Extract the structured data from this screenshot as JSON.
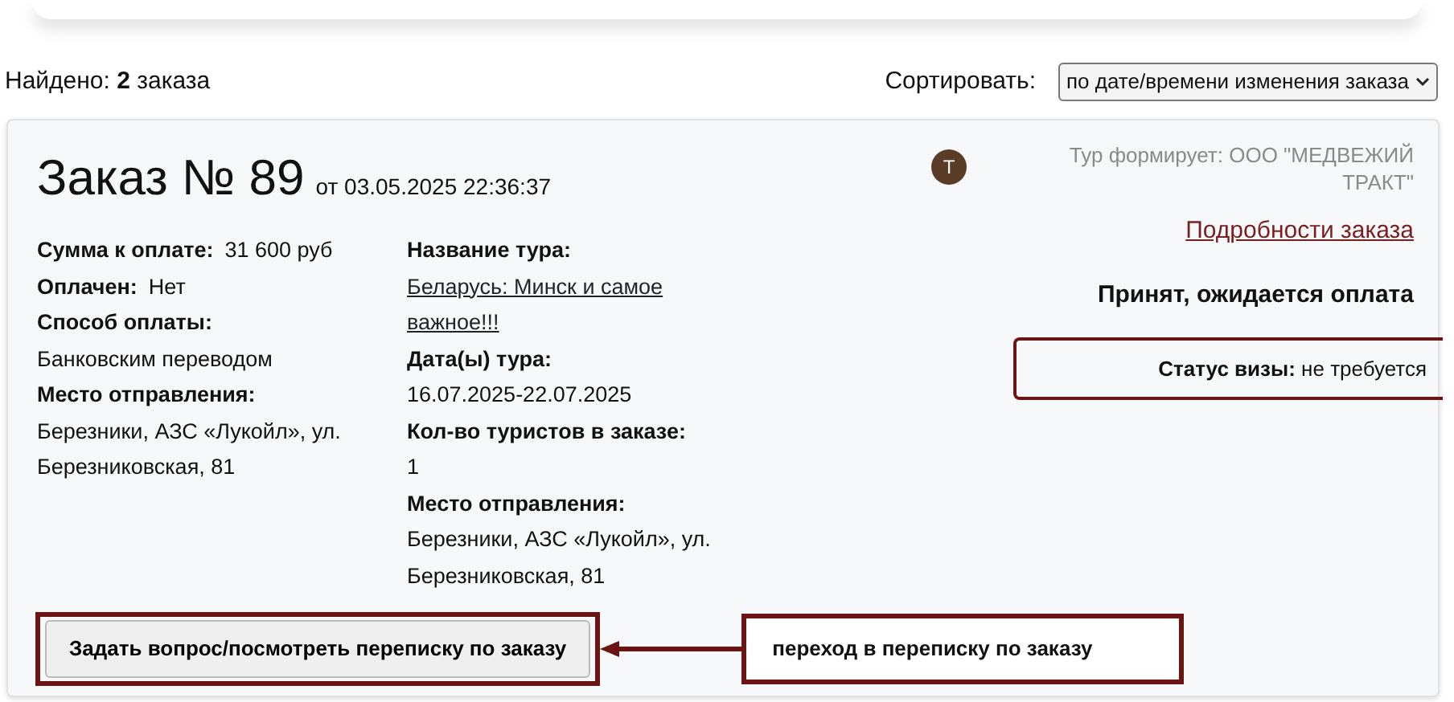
{
  "found": "Найдено: **2** заказа",
  "sort": {
    "label": "Сортировать:",
    "value": "по дате/времени изменения заказа"
  },
  "order": {
    "title": "Заказ № 89",
    "date": "от 03.05.2025 22:36:37",
    "avatar": "Т",
    "operator": "Тур формирует: ООО \"МЕДВЕЖИЙ ТРАКТ\"",
    "details_link": "Подробности заказа",
    "status": "Принят, ожидается оплата",
    "visa": "**Статус визы:** не требуется",
    "left": [
      {
        "kind": "inline",
        "label": "Сумма к оплате:",
        "value": "31 600 руб"
      },
      {
        "kind": "inline",
        "label": "Оплачен:",
        "value": "Нет"
      },
      {
        "kind": "stacked",
        "label": "Способ оплаты:",
        "value": "Банковским переводом"
      },
      {
        "kind": "stacked",
        "label": "Место отправления:",
        "value": "Березники, АЗС «Лукойл», ул. Березниковская, 81"
      }
    ],
    "middle": [
      {
        "kind": "link",
        "label": "Название тура:",
        "value": "Беларусь: Минск и самое важное!!!"
      },
      {
        "kind": "stacked",
        "label": "Дата(ы) тура:",
        "value": "16.07.2025-22.07.2025"
      },
      {
        "kind": "stacked",
        "label": "Кол-во туристов в заказе:",
        "value": "1"
      },
      {
        "kind": "stacked",
        "label": "Место отправления:",
        "value": "Березники, АЗС «Лукойл», ул. Березниковская, 81"
      }
    ],
    "button": "Задать вопрос/посмотреть переписку по заказу"
  },
  "callout": "переход в переписку по заказу"
}
